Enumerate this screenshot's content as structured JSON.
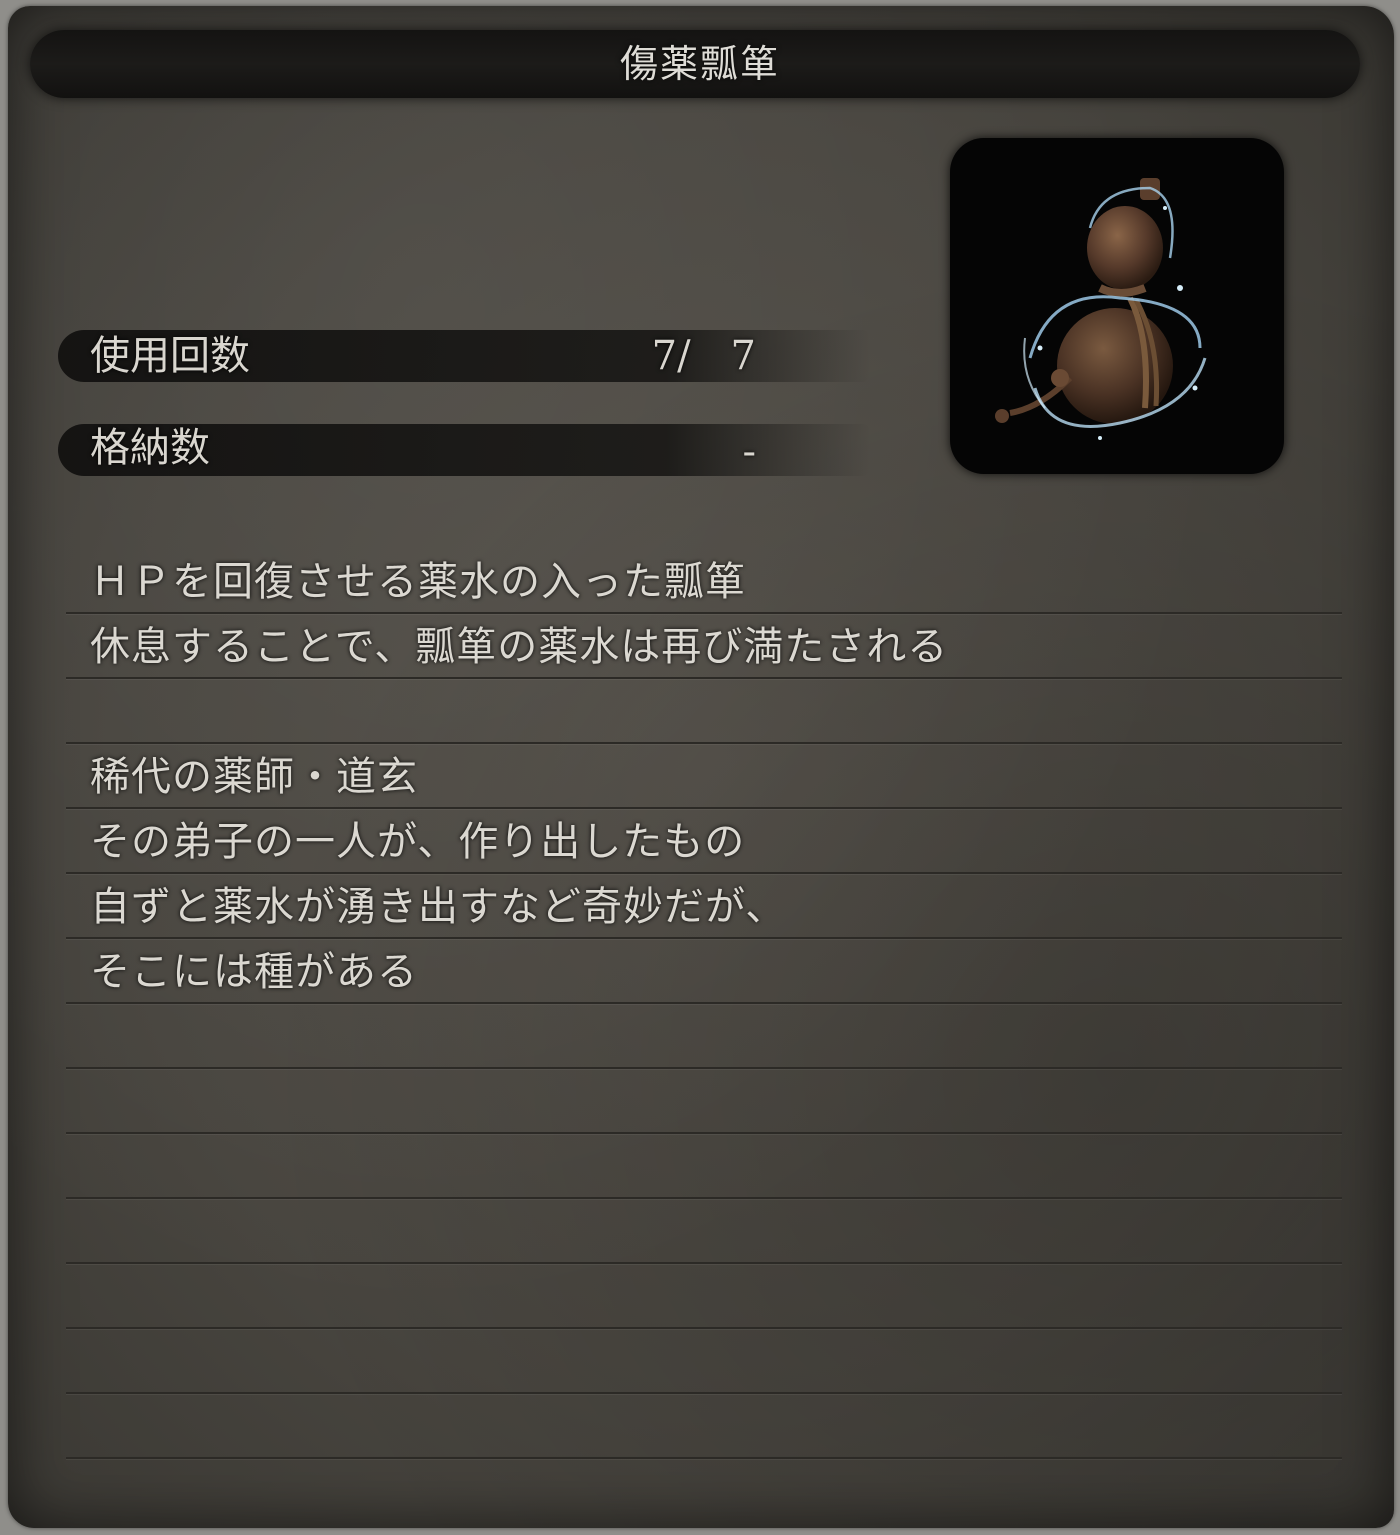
{
  "item": {
    "name": "傷薬瓢箪"
  },
  "stats": [
    {
      "label": "使用回数",
      "value": "7/　7"
    },
    {
      "label": "格納数",
      "value": "-"
    }
  ],
  "icon": {
    "name": "healing-gourd-icon"
  },
  "description": [
    "ＨＰを回復させる薬水の入った瓢箪",
    "休息することで、瓢箪の薬水は再び満たされる",
    "",
    "稀代の薬師・道玄",
    "その弟子の一人が、作り出したもの",
    "自ずと薬水が湧き出すなど奇妙だが、",
    "そこには種がある"
  ],
  "colors": {
    "panel": "#4a4741",
    "bar": "#161514",
    "text": "#dbd8d1"
  }
}
